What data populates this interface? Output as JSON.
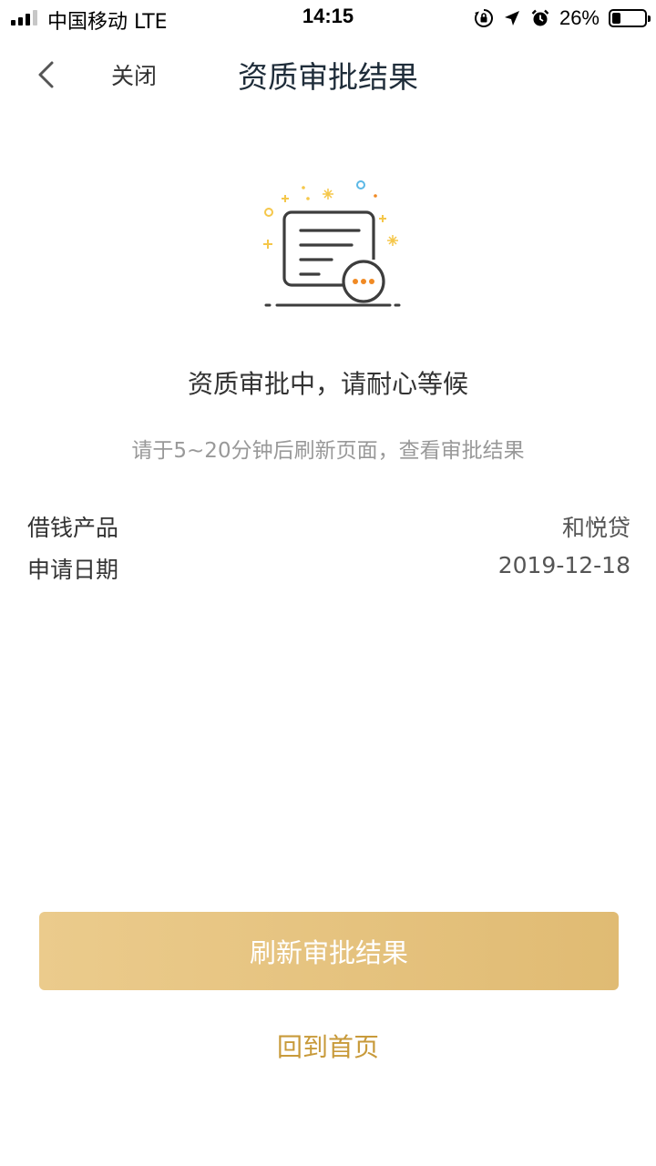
{
  "status_bar": {
    "carrier": "中国移动  LTE",
    "time": "14:15",
    "battery_percent_text": "26%",
    "battery_level": 0.26,
    "icons": [
      "signal-icon",
      "orientation-lock-icon",
      "location-arrow-icon",
      "alarm-icon",
      "battery-icon"
    ]
  },
  "nav": {
    "back_icon": "chevron-left-icon",
    "close_label": "关闭",
    "title": "资质审批结果"
  },
  "illustration": {
    "icon": "document-pending-icon",
    "colors": {
      "line": "#3d3d3d",
      "accent": "#f08a24",
      "sparkle_yellow": "#f5c74a",
      "sparkle_blue": "#5bb8e6"
    }
  },
  "status": {
    "title": "资质审批中，请耐心等候",
    "subtitle": "请于5~20分钟后刷新页面，查看审批结果"
  },
  "info": {
    "product_label": "借钱产品",
    "product_value": "和悦贷",
    "date_label": "申请日期",
    "date_value": "2019-12-18"
  },
  "actions": {
    "refresh_label": "刷新审批结果",
    "home_label": "回到首页",
    "colors": {
      "button_gradient_start": "#ebcb8c",
      "button_gradient_end": "#e0bb73",
      "link": "#c89a3a"
    }
  }
}
